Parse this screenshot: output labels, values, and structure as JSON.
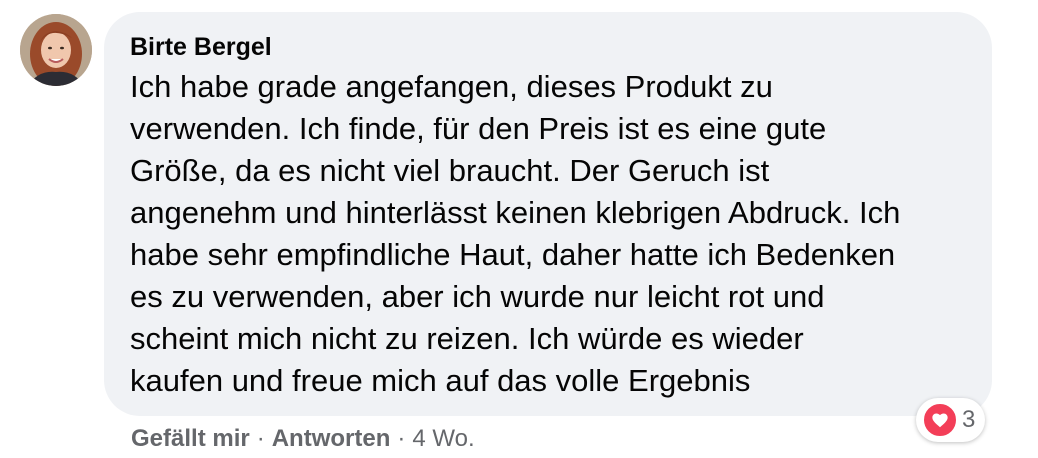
{
  "comment": {
    "author": "Birte Bergel",
    "text_lines": [
      "Ich habe grade angefangen, dieses Produkt zu",
      "verwenden. Ich finde, für den Preis ist es eine gute",
      "Größe, da es nicht viel braucht. Der Geruch ist",
      "angenehm und hinterlässt keinen klebrigen Abdruck. Ich",
      "habe sehr empfindliche Haut, daher hatte ich Bedenken",
      "es zu verwenden, aber ich wurde nur leicht rot und",
      "scheint mich nicht zu reizen. Ich würde es wieder",
      "kaufen und freue mich auf das volle Ergebnis"
    ],
    "reaction": {
      "icon": "heart-icon",
      "count": "3",
      "color": "#f33e58"
    },
    "actions": {
      "like_label": "Gefällt mir",
      "separator": "·",
      "reply_label": "Antworten",
      "timestamp": "4 Wo."
    }
  },
  "colors": {
    "bubble": "#f0f2f5",
    "text": "#050505",
    "secondary_text": "#65676b"
  }
}
